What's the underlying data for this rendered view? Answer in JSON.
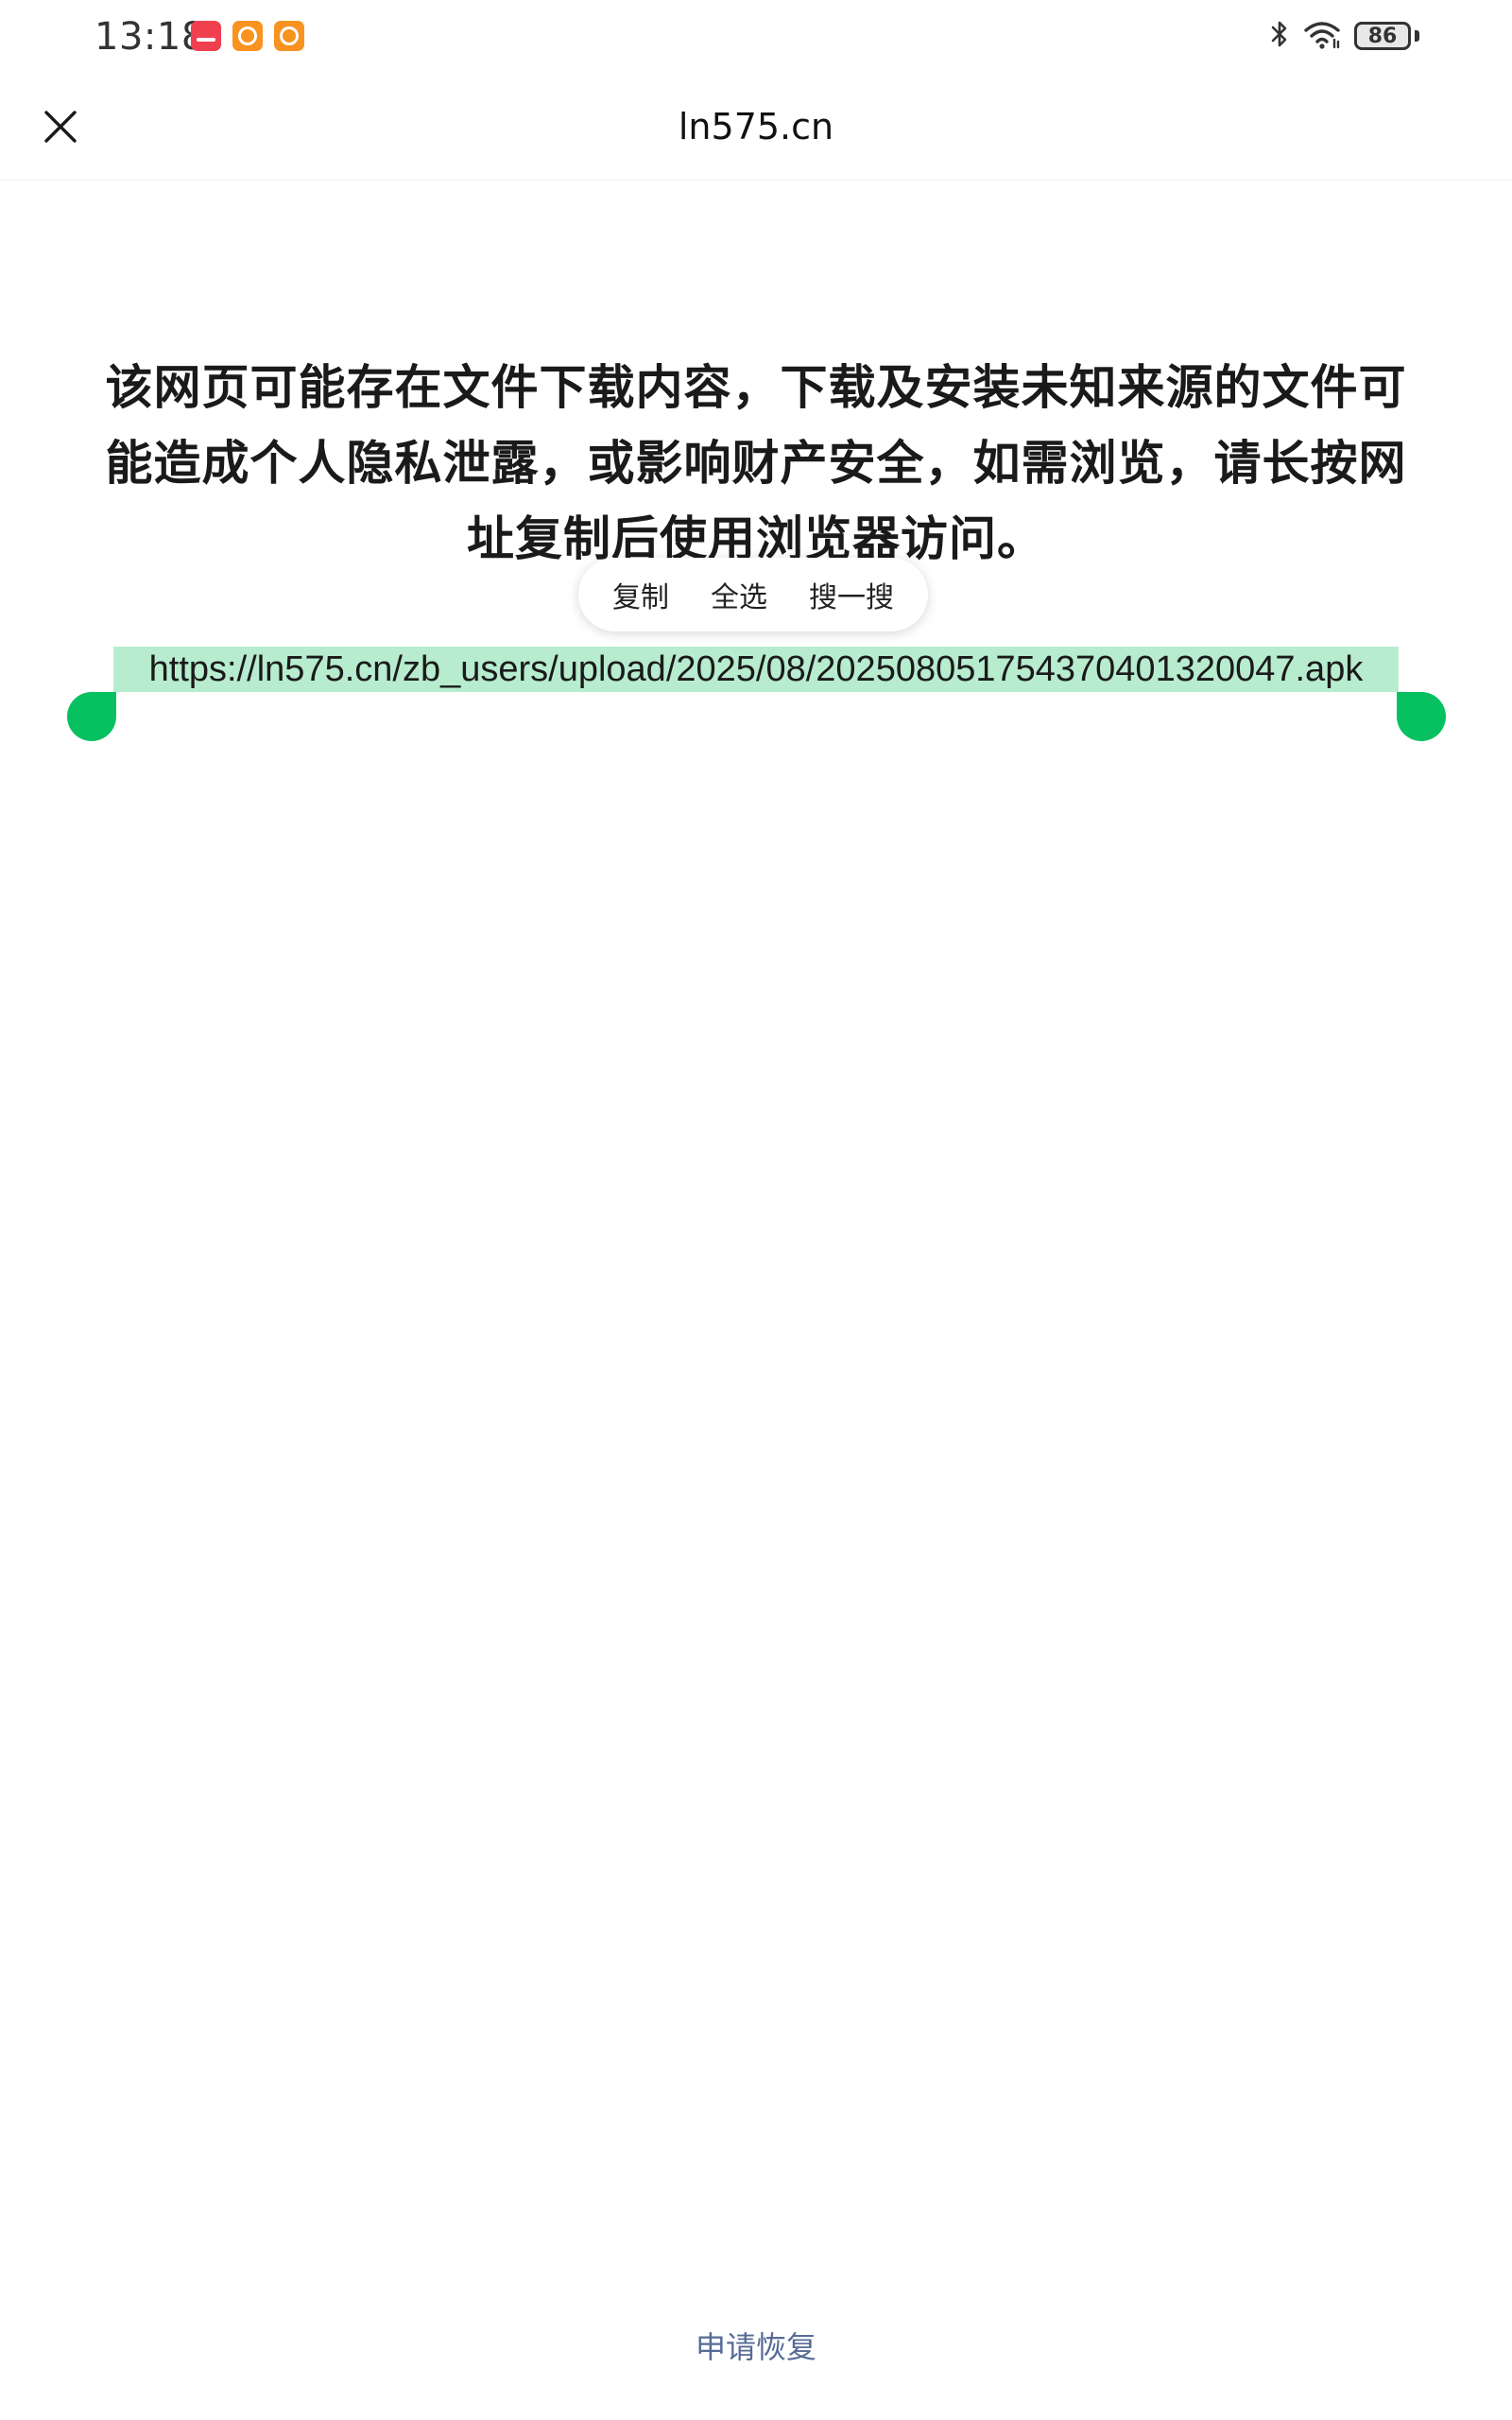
{
  "status_bar": {
    "time": "13:18",
    "notifications": [
      "huawei-app-icon",
      "taobao-app-icon",
      "taobao-app-icon"
    ],
    "battery_level": "86"
  },
  "nav": {
    "title": "ln575.cn",
    "close_icon": "close-icon"
  },
  "warning": {
    "message": "该网页可能存在文件下载内容，下载及安装未知来源的文件可能造成个人隐私泄露，或影响财产安全，如需浏览，请长按网址复制后使用浏览器访问。"
  },
  "context_menu": {
    "copy": "复制",
    "select_all": "全选",
    "search": "搜一搜"
  },
  "url": {
    "selected_text": "https://ln575.cn/zb_users/upload/2025/08/202508051754370401320047.apk"
  },
  "footer": {
    "restore_label": "申请恢复"
  },
  "colors": {
    "selection": "#b7ecce",
    "handle": "#07c160",
    "link": "#576b95"
  }
}
